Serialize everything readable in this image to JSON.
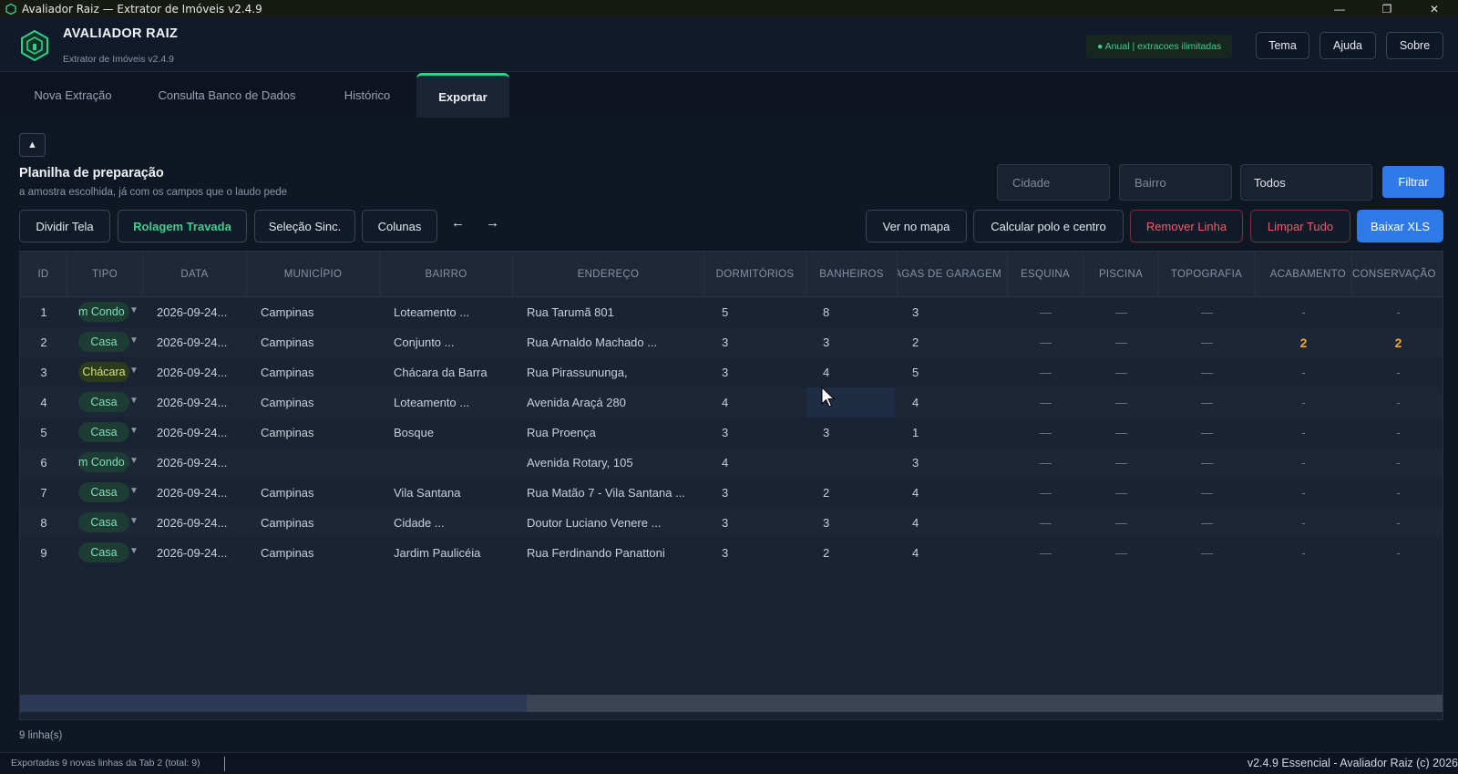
{
  "window": {
    "title": "Avaliador Raiz — Extrator de Imóveis v2.4.9",
    "controls": [
      "—",
      "❐",
      "✕"
    ]
  },
  "header": {
    "brand": "AVALIADOR RAIZ",
    "subtitle": "Extrator de Imóveis v2.4.9",
    "license": "● Anual | extracoes ilimitadas",
    "buttons": {
      "theme": "Tema",
      "help": "Ajuda",
      "about": "Sobre"
    }
  },
  "tabs": [
    {
      "label": "Nova Extração"
    },
    {
      "label": "Consulta Banco de Dados"
    },
    {
      "label": "Histórico"
    },
    {
      "label": "Exportar",
      "active": true
    }
  ],
  "panel": {
    "collapse_icon": "▲",
    "title": "Planilha de preparação",
    "subtitle": "a amostra escolhida, já com os campos que o laudo pede"
  },
  "filters": {
    "city_placeholder": "Cidade",
    "district_placeholder": "Bairro",
    "type_selected": "Todos",
    "filter_button": "Filtrar"
  },
  "toolbar": {
    "split": "Dividir Tela",
    "scroll_lock": "Rolagem Travada",
    "sync_selection": "Seleção Sinc.",
    "columns": "Colunas",
    "left_arrow": "←",
    "right_arrow": "→",
    "map": "Ver no mapa",
    "centroid": "Calcular polo e centro",
    "remove_row": "Remover Linha",
    "clear_all": "Limpar Tudo",
    "export_xls": "Baixar XLS"
  },
  "table": {
    "columns": [
      "ID",
      "TIPO",
      "DATA",
      "MUNICÍPIO",
      "BAIRRO",
      "ENDEREÇO",
      "DORMITÓRIOS",
      "BANHEIROS",
      "VAGAS DE GARAGEM",
      "ESQUINA",
      "PISCINA",
      "TOPOGRAFIA",
      "ACABAMENTO",
      "CONSERVAÇÃO"
    ],
    "rows": [
      {
        "id": "1",
        "tipo": "m Condo",
        "data": "2026-09-24...",
        "municipio": "Campinas",
        "bairro": "Loteamento ...",
        "endereco": "Rua Tarumã 801",
        "dorm": "5",
        "banh": "8",
        "vagas": "3",
        "esquina": "—",
        "piscina": "—",
        "topo": "—",
        "acab": "-",
        "cons": "-"
      },
      {
        "id": "2",
        "tipo": "Casa",
        "data": "2026-09-24...",
        "municipio": "Campinas",
        "bairro": "Conjunto ...",
        "endereco": "Rua Arnaldo Machado ...",
        "dorm": "3",
        "banh": "3",
        "vagas": "2",
        "esquina": "—",
        "piscina": "—",
        "topo": "—",
        "acab": "2",
        "cons": "2"
      },
      {
        "id": "3",
        "tipo": "Chácara",
        "data": "2026-09-24...",
        "municipio": "Campinas",
        "bairro": "Chácara da Barra",
        "endereco": "Rua Pirassununga,",
        "dorm": "3",
        "banh": "4",
        "vagas": "5",
        "esquina": "—",
        "piscina": "—",
        "topo": "—",
        "acab": "-",
        "cons": "-"
      },
      {
        "id": "4",
        "tipo": "Casa",
        "data": "2026-09-24...",
        "municipio": "Campinas",
        "bairro": "Loteamento ...",
        "endereco": "Avenida Araçá 280",
        "dorm": "4",
        "banh": "",
        "vagas": "4",
        "esquina": "—",
        "piscina": "—",
        "topo": "—",
        "acab": "-",
        "cons": "-"
      },
      {
        "id": "5",
        "tipo": "Casa",
        "data": "2026-09-24...",
        "municipio": "Campinas",
        "bairro": "Bosque",
        "endereco": "Rua Proença",
        "dorm": "3",
        "banh": "3",
        "vagas": "1",
        "esquina": "—",
        "piscina": "—",
        "topo": "—",
        "acab": "-",
        "cons": "-"
      },
      {
        "id": "6",
        "tipo": "m Condo",
        "data": "2026-09-24...",
        "municipio": "",
        "bairro": "",
        "endereco": "Avenida Rotary, 105",
        "dorm": "4",
        "banh": "",
        "vagas": "3",
        "esquina": "—",
        "piscina": "—",
        "topo": "—",
        "acab": "-",
        "cons": "-"
      },
      {
        "id": "7",
        "tipo": "Casa",
        "data": "2026-09-24...",
        "municipio": "Campinas",
        "bairro": "Vila Santana",
        "endereco": "Rua Matão 7 - Vila Santana ...",
        "dorm": "3",
        "banh": "2",
        "vagas": "4",
        "esquina": "—",
        "piscina": "—",
        "topo": "—",
        "acab": "-",
        "cons": "-"
      },
      {
        "id": "8",
        "tipo": "Casa",
        "data": "2026-09-24...",
        "municipio": "Campinas",
        "bairro": "Cidade ...",
        "endereco": "Doutor Luciano Venere ...",
        "dorm": "3",
        "banh": "3",
        "vagas": "4",
        "esquina": "—",
        "piscina": "—",
        "topo": "—",
        "acab": "-",
        "cons": "-"
      },
      {
        "id": "9",
        "tipo": "Casa",
        "data": "2026-09-24...",
        "municipio": "Campinas",
        "bairro": "Jardim Paulicéia",
        "endereco": "Rua Ferdinando Panattoni",
        "dorm": "3",
        "banh": "2",
        "vagas": "4",
        "esquina": "—",
        "piscina": "—",
        "topo": "—",
        "acab": "-",
        "cons": "-"
      }
    ],
    "caret": "▼"
  },
  "footer": {
    "row_count": "9 linha(s)",
    "status_left": "Exportadas 9 novas linhas da Tab 2 (total: 9)",
    "status_right": "v2.4.9 Essencial - Avaliador Raiz (c) 2026"
  },
  "colors": {
    "accent_green": "#3ecf8e",
    "primary_blue": "#2f7ae8",
    "danger_red": "#ef5d6a",
    "highlight_orange": "#f5a524"
  }
}
